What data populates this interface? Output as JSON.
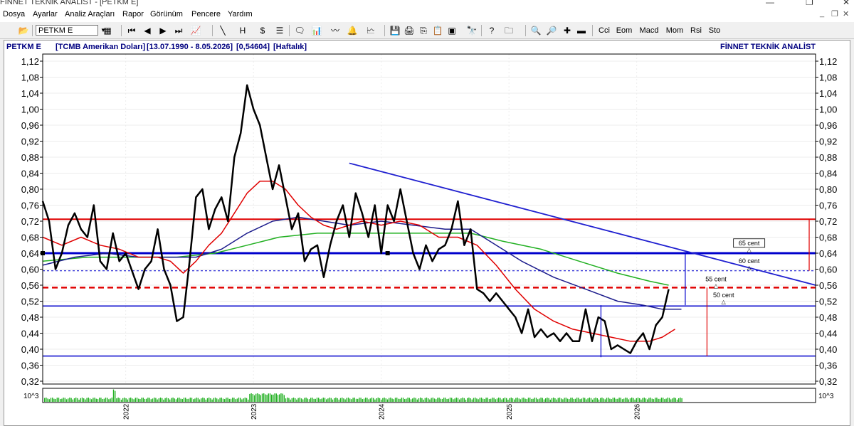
{
  "window": {
    "title": "FİNNET TEKNİK ANALİST - [PETKM E]",
    "controls": [
      "—",
      "❐",
      "✕"
    ],
    "mdi_controls": [
      "_",
      "❐",
      "✕"
    ]
  },
  "menu": [
    "Dosya",
    "Ayarlar",
    "Analiz Araçları",
    "Rapor",
    "Görünüm",
    "Pencere",
    "Yardım"
  ],
  "toolbar": {
    "symbol_value": "PETKM E",
    "indicators": [
      "Cci",
      "Eom",
      "Macd",
      "Mom",
      "Rsi",
      "Sto"
    ]
  },
  "chart_header": {
    "symbol": "PETKM E",
    "currency": "[TCMB Amerikan Doları]",
    "date_range": "[13.07.1990 - 8.05.2026]",
    "last_value": "[0,54604]",
    "period": "[Haftalık]",
    "brand": "FİNNET TEKNİK ANALİST"
  },
  "colors": {
    "price": "#000000",
    "ma_red": "#e00000",
    "ma_navy": "#1c1c8c",
    "ma_green": "#22b022",
    "hline_red": "#e00000",
    "hline_blue": "#0000cc",
    "trendline": "#2020d0",
    "volume": "#22b022"
  },
  "volume_label": "10^3",
  "chart_data": {
    "type": "line",
    "ylim": [
      0.32,
      1.12
    ],
    "y_ticks": [
      "1,12",
      "1,08",
      "1,04",
      "1,00",
      "0,96",
      "0,92",
      "0,88",
      "0,84",
      "0,80",
      "0,76",
      "0,72",
      "0,68",
      "0,64",
      "0,60",
      "0,56",
      "0,52",
      "0,48",
      "0,44",
      "0,40",
      "0,36",
      "0,32"
    ],
    "x_ticks": [
      {
        "label": "2022",
        "x": 2022.0
      },
      {
        "label": "2023",
        "x": 2023.0
      },
      {
        "label": "2024",
        "x": 2024.0
      },
      {
        "label": "2025",
        "x": 2025.0
      },
      {
        "label": "2026",
        "x": 2026.0
      }
    ],
    "xlim": [
      2021.35,
      2027.4
    ],
    "series": [
      {
        "key": "price",
        "points": [
          [
            2021.35,
            0.77
          ],
          [
            2021.4,
            0.72
          ],
          [
            2021.45,
            0.6
          ],
          [
            2021.5,
            0.64
          ],
          [
            2021.55,
            0.71
          ],
          [
            2021.6,
            0.74
          ],
          [
            2021.65,
            0.7
          ],
          [
            2021.7,
            0.68
          ],
          [
            2021.75,
            0.76
          ],
          [
            2021.8,
            0.62
          ],
          [
            2021.85,
            0.6
          ],
          [
            2021.9,
            0.69
          ],
          [
            2021.95,
            0.62
          ],
          [
            2022.0,
            0.64
          ],
          [
            2022.1,
            0.55
          ],
          [
            2022.15,
            0.6
          ],
          [
            2022.2,
            0.62
          ],
          [
            2022.25,
            0.7
          ],
          [
            2022.3,
            0.6
          ],
          [
            2022.35,
            0.56
          ],
          [
            2022.4,
            0.47
          ],
          [
            2022.45,
            0.48
          ],
          [
            2022.5,
            0.62
          ],
          [
            2022.55,
            0.78
          ],
          [
            2022.6,
            0.8
          ],
          [
            2022.65,
            0.7
          ],
          [
            2022.7,
            0.75
          ],
          [
            2022.75,
            0.78
          ],
          [
            2022.8,
            0.72
          ],
          [
            2022.85,
            0.88
          ],
          [
            2022.9,
            0.94
          ],
          [
            2022.95,
            1.06
          ],
          [
            2023.0,
            1.0
          ],
          [
            2023.05,
            0.96
          ],
          [
            2023.1,
            0.88
          ],
          [
            2023.15,
            0.8
          ],
          [
            2023.2,
            0.86
          ],
          [
            2023.25,
            0.78
          ],
          [
            2023.3,
            0.7
          ],
          [
            2023.35,
            0.74
          ],
          [
            2023.4,
            0.62
          ],
          [
            2023.45,
            0.65
          ],
          [
            2023.5,
            0.66
          ],
          [
            2023.55,
            0.58
          ],
          [
            2023.6,
            0.66
          ],
          [
            2023.65,
            0.72
          ],
          [
            2023.7,
            0.76
          ],
          [
            2023.75,
            0.68
          ],
          [
            2023.8,
            0.79
          ],
          [
            2023.85,
            0.74
          ],
          [
            2023.9,
            0.68
          ],
          [
            2023.95,
            0.76
          ],
          [
            2024.0,
            0.64
          ],
          [
            2024.05,
            0.76
          ],
          [
            2024.1,
            0.72
          ],
          [
            2024.15,
            0.8
          ],
          [
            2024.2,
            0.72
          ],
          [
            2024.25,
            0.64
          ],
          [
            2024.3,
            0.6
          ],
          [
            2024.35,
            0.66
          ],
          [
            2024.4,
            0.62
          ],
          [
            2024.45,
            0.65
          ],
          [
            2024.5,
            0.66
          ],
          [
            2024.55,
            0.7
          ],
          [
            2024.6,
            0.77
          ],
          [
            2024.65,
            0.66
          ],
          [
            2024.7,
            0.7
          ],
          [
            2024.75,
            0.55
          ],
          [
            2024.8,
            0.54
          ],
          [
            2024.85,
            0.52
          ],
          [
            2024.9,
            0.54
          ],
          [
            2024.95,
            0.52
          ],
          [
            2025.0,
            0.5
          ],
          [
            2025.05,
            0.48
          ],
          [
            2025.1,
            0.44
          ],
          [
            2025.15,
            0.5
          ],
          [
            2025.2,
            0.43
          ],
          [
            2025.25,
            0.45
          ],
          [
            2025.3,
            0.43
          ],
          [
            2025.35,
            0.44
          ],
          [
            2025.4,
            0.42
          ],
          [
            2025.45,
            0.44
          ],
          [
            2025.5,
            0.42
          ],
          [
            2025.55,
            0.42
          ],
          [
            2025.6,
            0.5
          ],
          [
            2025.65,
            0.42
          ],
          [
            2025.7,
            0.48
          ],
          [
            2025.75,
            0.47
          ],
          [
            2025.8,
            0.4
          ],
          [
            2025.85,
            0.41
          ],
          [
            2025.9,
            0.4
          ],
          [
            2025.95,
            0.39
          ],
          [
            2026.0,
            0.42
          ],
          [
            2026.05,
            0.44
          ],
          [
            2026.1,
            0.4
          ],
          [
            2026.15,
            0.46
          ],
          [
            2026.2,
            0.48
          ],
          [
            2026.25,
            0.55
          ]
        ]
      },
      {
        "key": "ma_red",
        "points": [
          [
            2021.35,
            0.68
          ],
          [
            2021.5,
            0.66
          ],
          [
            2021.65,
            0.68
          ],
          [
            2021.8,
            0.66
          ],
          [
            2021.95,
            0.65
          ],
          [
            2022.1,
            0.63
          ],
          [
            2022.25,
            0.63
          ],
          [
            2022.35,
            0.62
          ],
          [
            2022.45,
            0.59
          ],
          [
            2022.55,
            0.62
          ],
          [
            2022.65,
            0.66
          ],
          [
            2022.75,
            0.69
          ],
          [
            2022.85,
            0.74
          ],
          [
            2022.95,
            0.79
          ],
          [
            2023.05,
            0.82
          ],
          [
            2023.15,
            0.82
          ],
          [
            2023.25,
            0.8
          ],
          [
            2023.35,
            0.76
          ],
          [
            2023.45,
            0.73
          ],
          [
            2023.55,
            0.71
          ],
          [
            2023.65,
            0.7
          ],
          [
            2023.75,
            0.71
          ],
          [
            2023.85,
            0.72
          ],
          [
            2024.0,
            0.71
          ],
          [
            2024.15,
            0.72
          ],
          [
            2024.3,
            0.71
          ],
          [
            2024.45,
            0.68
          ],
          [
            2024.6,
            0.68
          ],
          [
            2024.75,
            0.66
          ],
          [
            2024.9,
            0.61
          ],
          [
            2025.05,
            0.55
          ],
          [
            2025.2,
            0.5
          ],
          [
            2025.35,
            0.47
          ],
          [
            2025.5,
            0.45
          ],
          [
            2025.65,
            0.44
          ],
          [
            2025.8,
            0.43
          ],
          [
            2025.95,
            0.42
          ],
          [
            2026.1,
            0.42
          ],
          [
            2026.2,
            0.43
          ],
          [
            2026.3,
            0.45
          ]
        ]
      },
      {
        "key": "ma_navy",
        "points": [
          [
            2021.35,
            0.61
          ],
          [
            2021.6,
            0.63
          ],
          [
            2021.85,
            0.64
          ],
          [
            2022.1,
            0.63
          ],
          [
            2022.35,
            0.63
          ],
          [
            2022.55,
            0.63
          ],
          [
            2022.75,
            0.65
          ],
          [
            2022.95,
            0.69
          ],
          [
            2023.15,
            0.72
          ],
          [
            2023.35,
            0.73
          ],
          [
            2023.55,
            0.72
          ],
          [
            2023.75,
            0.71
          ],
          [
            2024.0,
            0.72
          ],
          [
            2024.25,
            0.71
          ],
          [
            2024.5,
            0.7
          ],
          [
            2024.7,
            0.7
          ],
          [
            2024.9,
            0.66
          ],
          [
            2025.1,
            0.62
          ],
          [
            2025.35,
            0.58
          ],
          [
            2025.6,
            0.55
          ],
          [
            2025.85,
            0.52
          ],
          [
            2026.05,
            0.51
          ],
          [
            2026.2,
            0.5
          ],
          [
            2026.35,
            0.5
          ]
        ]
      },
      {
        "key": "ma_green",
        "points": [
          [
            2021.35,
            0.62
          ],
          [
            2021.7,
            0.63
          ],
          [
            2022.0,
            0.63
          ],
          [
            2022.4,
            0.63
          ],
          [
            2022.7,
            0.64
          ],
          [
            2022.95,
            0.66
          ],
          [
            2023.2,
            0.68
          ],
          [
            2023.5,
            0.69
          ],
          [
            2023.8,
            0.69
          ],
          [
            2024.1,
            0.69
          ],
          [
            2024.4,
            0.69
          ],
          [
            2024.7,
            0.69
          ],
          [
            2024.95,
            0.67
          ],
          [
            2025.25,
            0.65
          ],
          [
            2025.55,
            0.62
          ],
          [
            2025.85,
            0.59
          ],
          [
            2026.1,
            0.57
          ],
          [
            2026.25,
            0.56
          ]
        ]
      }
    ],
    "horizontal_lines": [
      {
        "y": 0.725,
        "color": "hline_red",
        "style": "solid",
        "width": 2
      },
      {
        "y": 0.64,
        "color": "hline_blue",
        "style": "solid",
        "width": 3
      },
      {
        "y": 0.596,
        "color": "hline_blue",
        "style": "dashed",
        "width": 1
      },
      {
        "y": 0.554,
        "color": "hline_red",
        "style": "dashed",
        "width": 2.5
      },
      {
        "y": 0.508,
        "color": "hline_blue",
        "style": "solid",
        "width": 1.5
      },
      {
        "y": 0.383,
        "color": "hline_blue",
        "style": "solid",
        "width": 1.5
      }
    ],
    "trendline": {
      "from": [
        2023.75,
        0.865
      ],
      "to": [
        2027.4,
        0.56
      ]
    },
    "annotations": [
      {
        "label": "65 cent",
        "x": 2026.88,
        "y": 0.66
      },
      {
        "label": "60 cent",
        "x": 2026.88,
        "y": 0.615
      },
      {
        "label": "55 cent",
        "x": 2026.62,
        "y": 0.57
      },
      {
        "label": "50 cent",
        "x": 2026.68,
        "y": 0.53
      }
    ]
  }
}
